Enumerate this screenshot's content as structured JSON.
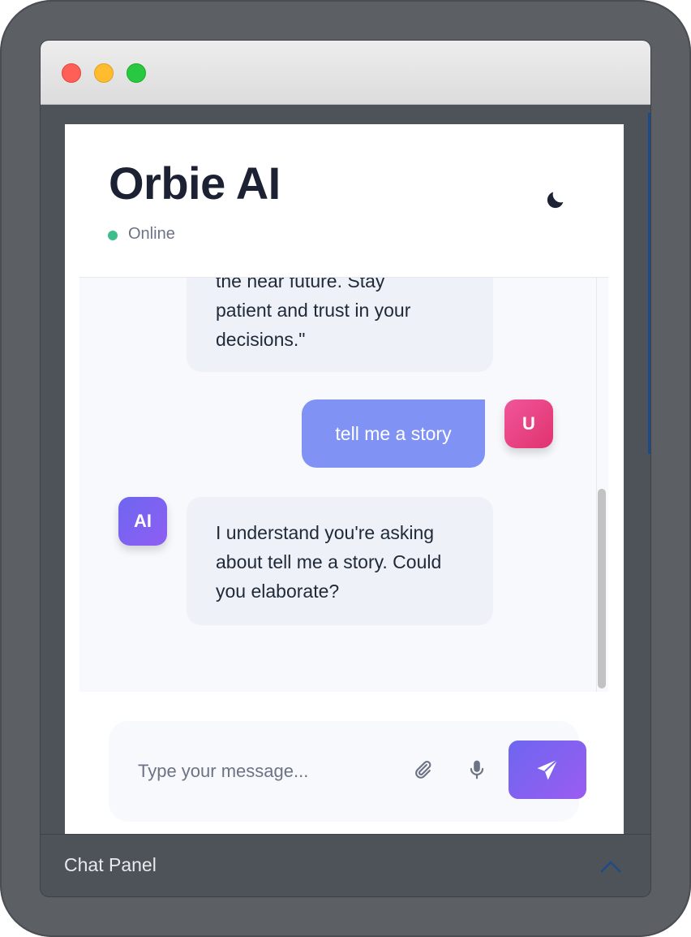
{
  "window": {
    "controls": [
      "close",
      "minimize",
      "zoom"
    ]
  },
  "header": {
    "title": "Orbie AI",
    "status": "Online",
    "status_color": "#3ebd8c",
    "theme_toggle_icon": "moon-icon"
  },
  "messages": [
    {
      "role": "ai",
      "lines": [
        "the near future. Stay",
        "patient and trust in your",
        "decisions.\""
      ]
    },
    {
      "role": "user",
      "avatar": "U",
      "text": "tell me a story"
    },
    {
      "role": "ai",
      "avatar": "AI",
      "lines": [
        "I understand you're asking",
        "about tell me a story. Could",
        "you elaborate?"
      ]
    }
  ],
  "composer": {
    "placeholder": "Type your message...",
    "value": "",
    "attach_icon": "paperclip-icon",
    "mic_icon": "microphone-icon",
    "send_icon": "send-icon"
  },
  "panel": {
    "label": "Chat Panel",
    "toggle_icon": "chevron-up-icon"
  },
  "colors": {
    "accent": "#7b67f0",
    "user_bubble": "#8093f5",
    "user_avatar": "#e8437f",
    "ai_bubble": "#eef1f7"
  }
}
